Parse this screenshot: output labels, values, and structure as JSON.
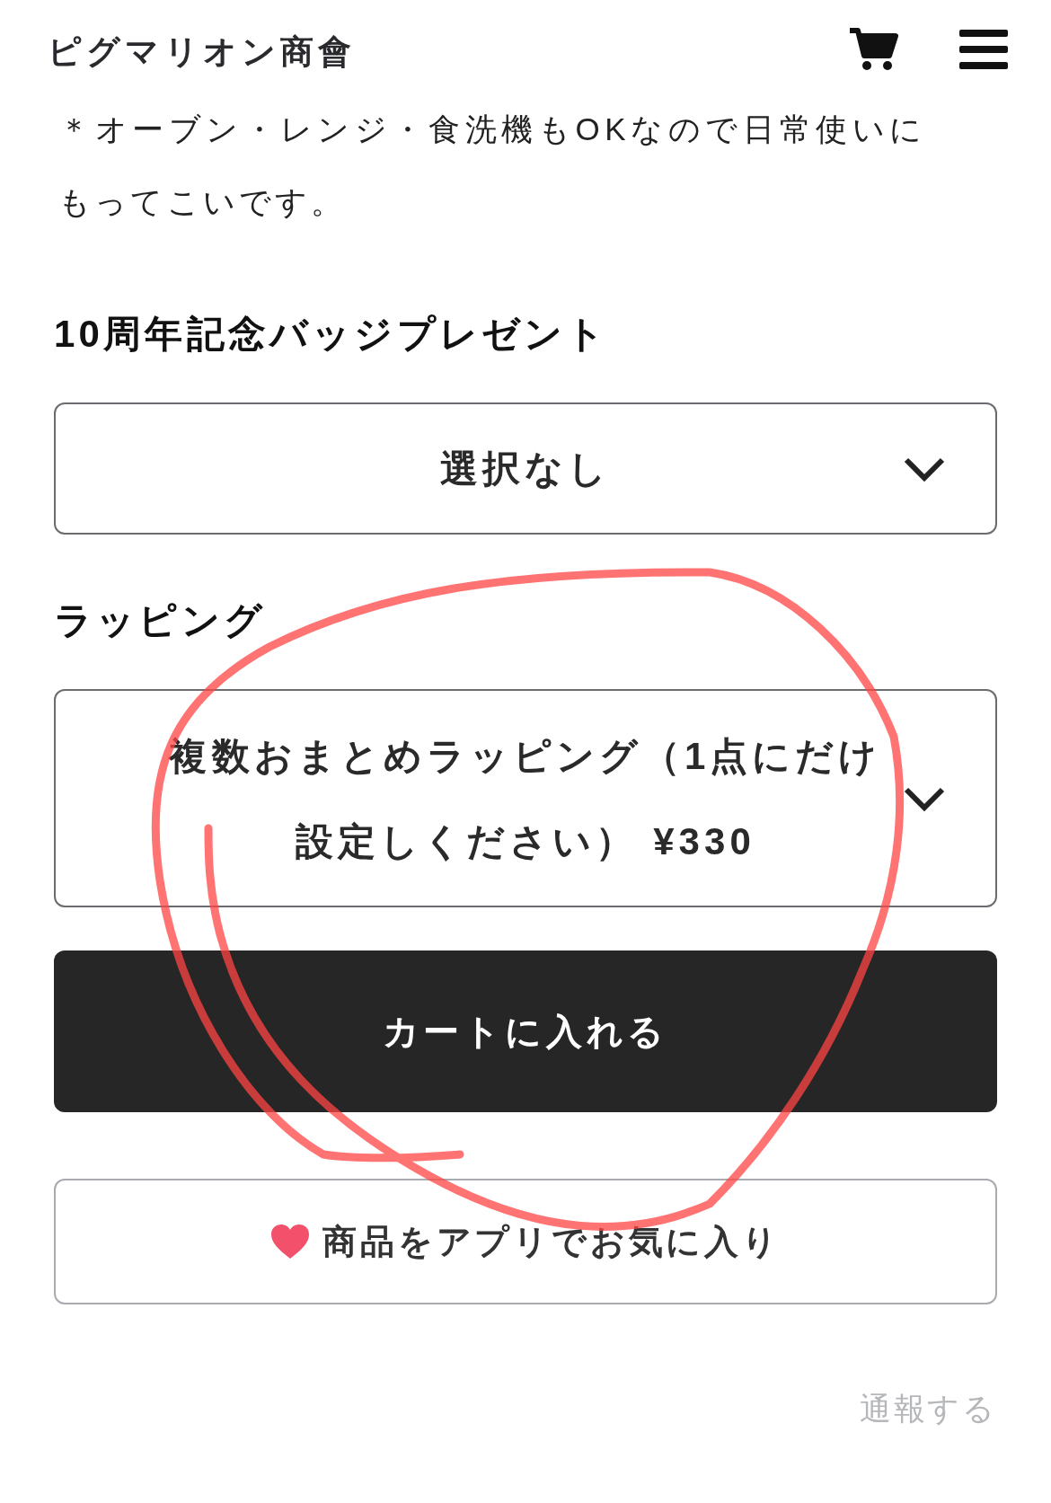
{
  "header": {
    "title": "ピグマリオン商會"
  },
  "description": [
    "＊オーブン・レンジ・食洗機もOKなので日常使いに",
    "もってこいです。"
  ],
  "options": [
    {
      "label": "10周年記念バッジプレゼント",
      "value": "選択なし"
    },
    {
      "label": "ラッピング",
      "value": "複数おまとめラッピング（1点にだけ設定しください） ¥330"
    }
  ],
  "cart_button": "カートに入れる",
  "favorite_button": "商品をアプリでお気に入り",
  "report_link": "通報する"
}
